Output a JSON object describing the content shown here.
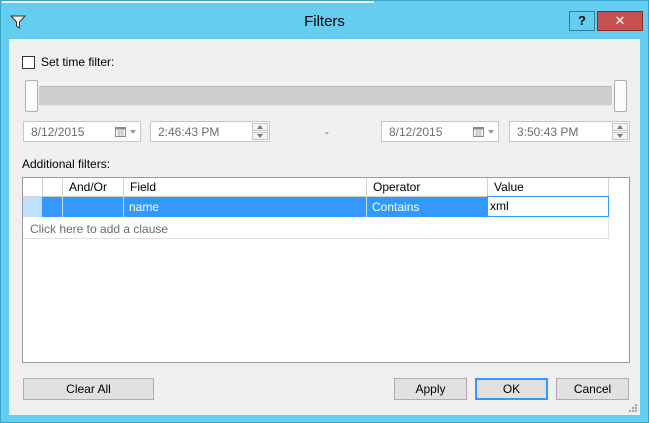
{
  "window": {
    "title": "Filters",
    "help_label": "?",
    "close_label": "✕"
  },
  "time_filter": {
    "label": "Set time filter:",
    "checked": false,
    "start_date": "8/12/2015",
    "start_time": "2:46:43 PM",
    "separator": "-",
    "end_date": "8/12/2015",
    "end_time": "3:50:43 PM"
  },
  "additional_filters": {
    "label": "Additional filters:",
    "columns": [
      "And/Or",
      "Field",
      "Operator",
      "Value"
    ],
    "rows": [
      {
        "and_or": "",
        "field": "name",
        "operator": "Contains",
        "value": "xml"
      }
    ],
    "add_clause": "Click here to add a clause"
  },
  "buttons": {
    "clear_all": "Clear All",
    "apply": "Apply",
    "ok": "OK",
    "cancel": "Cancel"
  },
  "icons": {
    "title": "funnel-icon",
    "calendar": "calendar-icon"
  },
  "colors": {
    "title_bar": "#65cdef",
    "close_button": "#c75050",
    "selection": "#3399ff"
  }
}
